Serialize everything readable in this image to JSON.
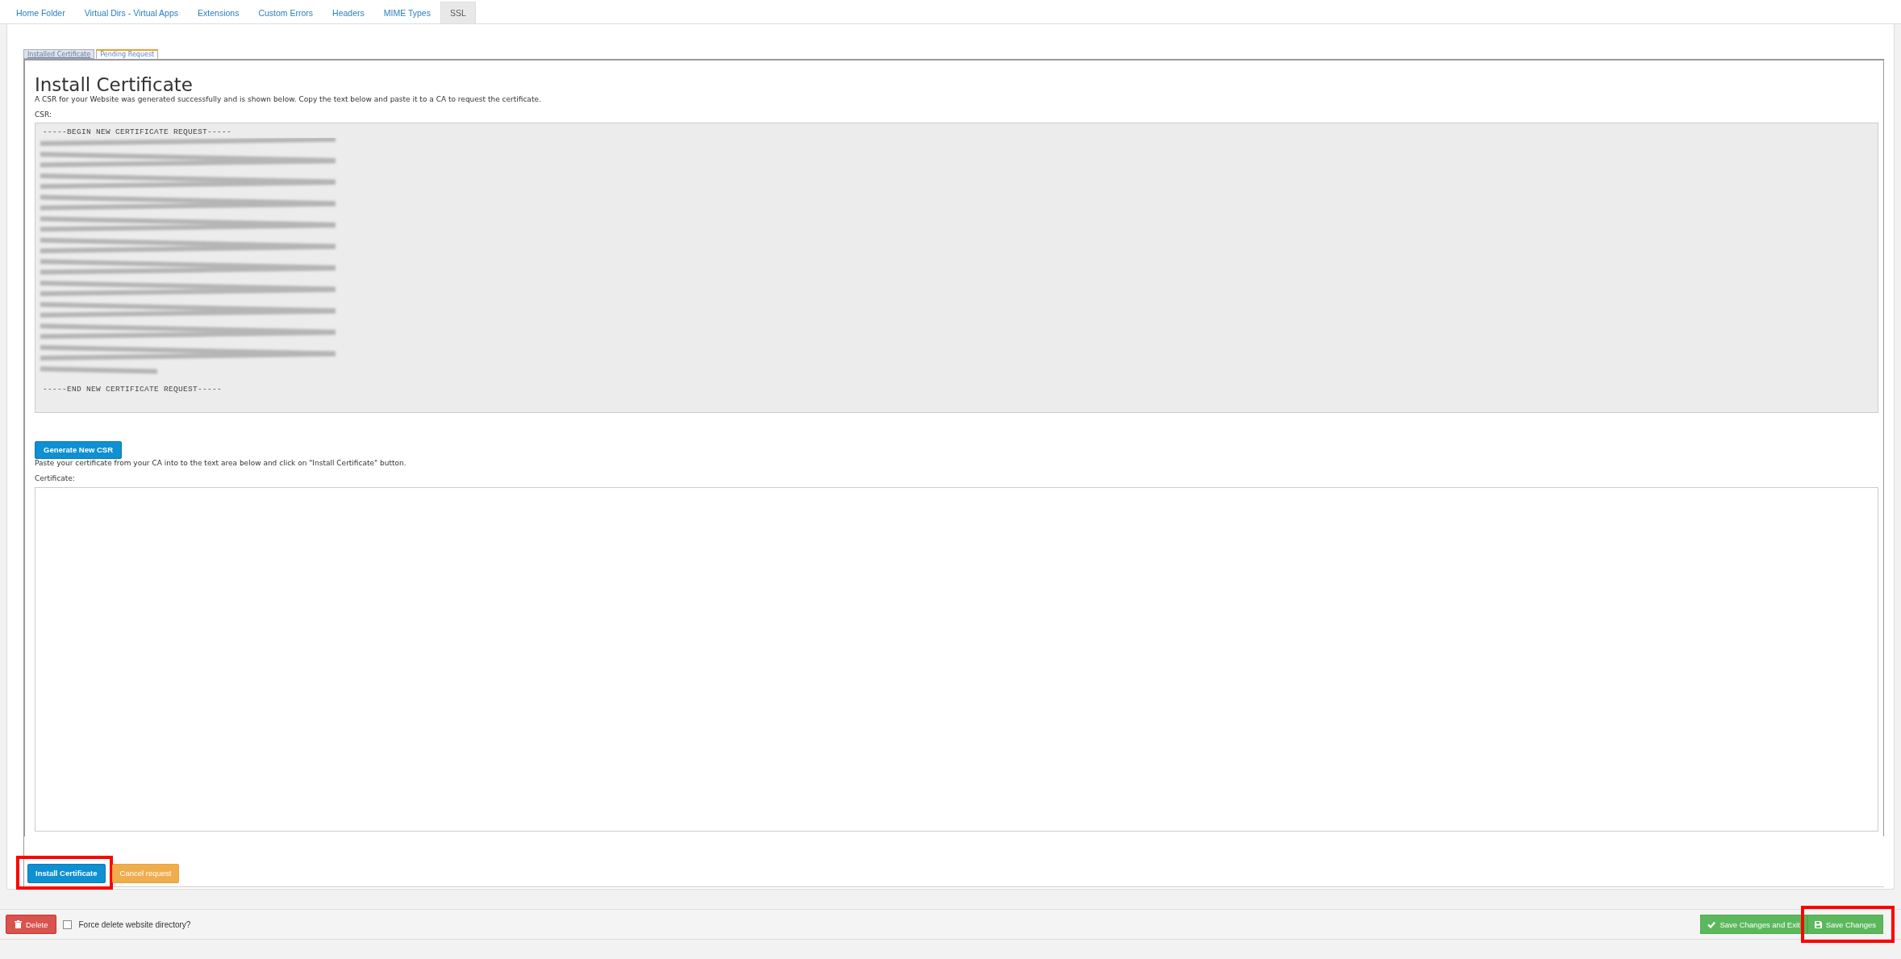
{
  "tabs": [
    {
      "label": "Home Folder",
      "selected": false
    },
    {
      "label": "Virtual Dirs - Virtual Apps",
      "selected": false
    },
    {
      "label": "Extensions",
      "selected": false
    },
    {
      "label": "Custom Errors",
      "selected": false
    },
    {
      "label": "Headers",
      "selected": false
    },
    {
      "label": "MIME Types",
      "selected": false
    },
    {
      "label": "SSL",
      "selected": true
    }
  ],
  "sub_tabs": [
    {
      "label": "Installed Certificate",
      "selected": false
    },
    {
      "label": "Pending Request",
      "selected": true
    }
  ],
  "heading": "Install Certificate",
  "intro": "A CSR for your Website was generated successfully and is shown below. Copy the text below and paste it to a CA to request the certificate.",
  "csr": {
    "label": "CSR:",
    "begin_line": "-----BEGIN NEW CERTIFICATE REQUEST-----",
    "end_line": "-----END NEW CERTIFICATE REQUEST-----"
  },
  "generate_button": "Generate New CSR",
  "paste_instructions": "Paste your certificate from your CA into to the text area below and click on \"Install Certificate\" button.",
  "certificate": {
    "label": "Certificate:"
  },
  "actions": [
    {
      "label": "Install Certificate",
      "kind": "primary",
      "highlighted": true
    },
    {
      "label": "Cancel request",
      "kind": "warning",
      "highlighted": false
    }
  ],
  "footer": {
    "delete_button": "Delete",
    "force_delete": {
      "label": "Force delete website directory?",
      "checked": false
    },
    "buttons": [
      {
        "label": "Save Changes and Exit",
        "kind": "check",
        "highlighted": false
      },
      {
        "label": "Save Changes",
        "kind": "save",
        "highlighted": true
      }
    ]
  }
}
